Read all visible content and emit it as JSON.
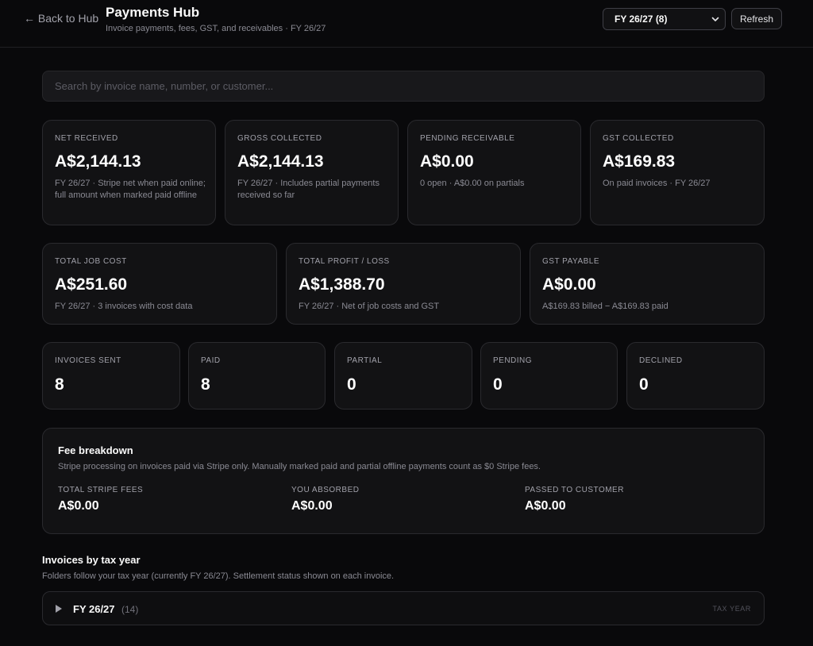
{
  "header": {
    "back_label": "← Back to Hub",
    "title": "Payments Hub",
    "subtitle": "Invoice payments, fees, GST, and receivables · FY 26/27",
    "fy_selected": "FY 26/27 (8)",
    "refresh_label": "Refresh"
  },
  "search": {
    "placeholder": "Search by invoice name, number, or customer..."
  },
  "stats_row1": [
    {
      "label": "NET RECEIVED",
      "value": "A$2,144.13",
      "sub": "FY 26/27 · Stripe net when paid online; full amount when marked paid offline"
    },
    {
      "label": "GROSS COLLECTED",
      "value": "A$2,144.13",
      "sub": "FY 26/27 · Includes partial payments received so far"
    },
    {
      "label": "PENDING RECEIVABLE",
      "value": "A$0.00",
      "sub": "0 open · A$0.00 on partials"
    },
    {
      "label": "GST COLLECTED",
      "value": "A$169.83",
      "sub": "On paid invoices · FY 26/27"
    }
  ],
  "stats_row2": [
    {
      "label": "TOTAL JOB COST",
      "value": "A$251.60",
      "sub": "FY 26/27 · 3 invoices with cost data"
    },
    {
      "label": "TOTAL PROFIT / LOSS",
      "value": "A$1,388.70",
      "sub": "FY 26/27 · Net of job costs and GST"
    },
    {
      "label": "GST PAYABLE",
      "value": "A$0.00",
      "sub": "A$169.83 billed − A$169.83 paid"
    }
  ],
  "counts": [
    {
      "label": "INVOICES SENT",
      "value": "8"
    },
    {
      "label": "PAID",
      "value": "8"
    },
    {
      "label": "PARTIAL",
      "value": "0"
    },
    {
      "label": "PENDING",
      "value": "0"
    },
    {
      "label": "DECLINED",
      "value": "0"
    }
  ],
  "fees": {
    "title": "Fee breakdown",
    "description": "Stripe processing on invoices paid via Stripe only. Manually marked paid and partial offline payments count as $0 Stripe fees.",
    "items": [
      {
        "label": "TOTAL STRIPE FEES",
        "value": "A$0.00"
      },
      {
        "label": "YOU ABSORBED",
        "value": "A$0.00"
      },
      {
        "label": "PASSED TO CUSTOMER",
        "value": "A$0.00"
      }
    ]
  },
  "invoices_section": {
    "title": "Invoices by tax year",
    "description": "Folders follow your tax year (currently FY 26/27). Settlement status shown on each invoice.",
    "folders": [
      {
        "name": "FY 26/27",
        "count": "(14)",
        "tag": "TAX YEAR"
      }
    ]
  },
  "icons": {
    "folder_toggle": "play-triangle-icon",
    "select_chevron": "chevron-down-icon"
  }
}
